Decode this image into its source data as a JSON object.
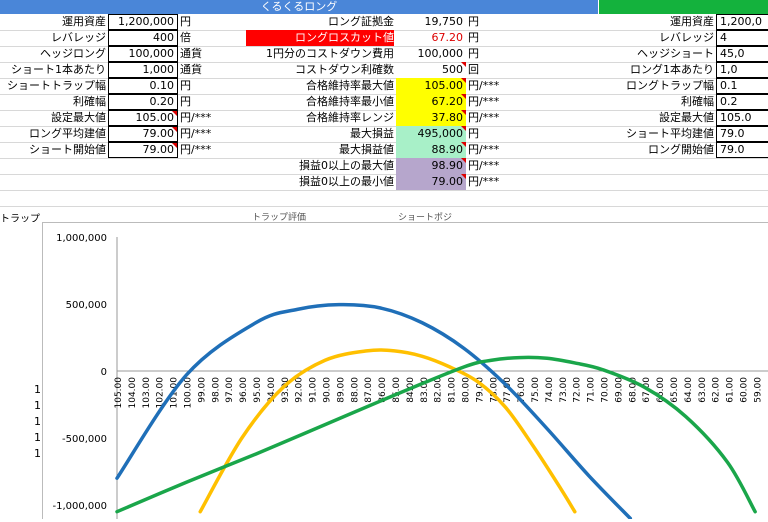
{
  "banner": {
    "title": "くるくるロング"
  },
  "left_block": [
    {
      "label": "運用資産",
      "value": "1,200,000",
      "unit": "円"
    },
    {
      "label": "レバレッジ",
      "value": "400",
      "unit": "倍"
    },
    {
      "label": "ヘッジロング",
      "value": "100,000",
      "unit": "通貨"
    },
    {
      "label": "ショート1本あたり",
      "value": "1,000",
      "unit": "通貨"
    },
    {
      "label": "ショートトラップ幅",
      "value": "0.10",
      "unit": "円"
    },
    {
      "label": "利確幅",
      "value": "0.20",
      "unit": "円"
    },
    {
      "label": "設定最大値",
      "value": "105.00",
      "unit": "円/***"
    },
    {
      "label": "ロング平均建値",
      "value": "79.00",
      "unit": "円/***"
    },
    {
      "label": "ショート開始値",
      "value": "79.00",
      "unit": "円/***"
    }
  ],
  "mid_block": [
    {
      "label": "ロング証拠金",
      "value": "19,750",
      "unit": "円"
    },
    {
      "label": "ロングロスカット値",
      "value": "67.20",
      "unit": "円"
    },
    {
      "label": "1円分のコストダウン費用",
      "value": "100,000",
      "unit": "円"
    },
    {
      "label": "コストダウン利確数",
      "value": "500",
      "unit": "回"
    },
    {
      "label": "合格維持率最大値",
      "value": "105.00",
      "unit": "円/***"
    },
    {
      "label": "合格維持率最小値",
      "value": "67.20",
      "unit": "円/***"
    },
    {
      "label": "合格維持率レンジ",
      "value": "37.80",
      "unit": "円/***"
    },
    {
      "label": "最大損益",
      "value": "495,000",
      "unit": "円"
    },
    {
      "label": "最大損益値",
      "value": "88.90",
      "unit": "円/***"
    },
    {
      "label": "損益0以上の最大値",
      "value": "98.90",
      "unit": "円/***"
    },
    {
      "label": "損益0以上の最小値",
      "value": "79.00",
      "unit": "円/***"
    }
  ],
  "right_block": [
    {
      "label": "運用資産",
      "value": "1,200,0"
    },
    {
      "label": "レバレッジ",
      "value": "4"
    },
    {
      "label": "ヘッジショート",
      "value": "45,0"
    },
    {
      "label": "ロング1本あたり",
      "value": "1,0"
    },
    {
      "label": "ロングトラップ幅",
      "value": "0.1"
    },
    {
      "label": "利確幅",
      "value": "0.2"
    },
    {
      "label": "設定最大値",
      "value": "105.0"
    },
    {
      "label": "ショート平均建値",
      "value": "79.0"
    },
    {
      "label": "ロング開始値",
      "value": "79.0"
    }
  ],
  "header_strip": {
    "left": "トラップ",
    "items": [
      "トラップ評価",
      "ショートポジ"
    ]
  },
  "row_stubs": [
    "1",
    "1",
    "1",
    "1",
    "1"
  ],
  "colors": {
    "banner_blue": "#4a86d8",
    "banner_green": "#14b23d",
    "red_cell": "#ff0000",
    "yellow_cell": "#ffff00",
    "mint_cell": "#a8f0c8",
    "lavender_cell": "#b6a6cc",
    "series_blue": "#1f6fb8",
    "series_orange": "#ffc000",
    "series_green": "#1aa64a"
  },
  "chart_data": {
    "type": "line",
    "y_ticks": [
      "1,000,000",
      "500,000",
      "0",
      "-500,000",
      "-1,000,000"
    ],
    "ylim": [
      -1000000,
      1000000
    ],
    "x_categories": [
      "105.00",
      "104.00",
      "103.00",
      "102.00",
      "101.00",
      "100.00",
      "99.00",
      "98.00",
      "97.00",
      "96.00",
      "95.00",
      "94.00",
      "93.00",
      "92.00",
      "91.00",
      "90.00",
      "89.00",
      "88.00",
      "87.00",
      "86.00",
      "85.00",
      "84.00",
      "83.00",
      "82.00",
      "81.00",
      "80.00",
      "79.00",
      "78.00",
      "77.00",
      "76.00",
      "75.00",
      "74.00",
      "73.00",
      "72.00",
      "71.00",
      "70.00",
      "69.00",
      "68.00",
      "67.00",
      "66.00",
      "65.00",
      "64.00",
      "63.00",
      "62.00",
      "61.00",
      "60.00",
      "59.00"
    ],
    "series": [
      {
        "color": "#1f6fb8",
        "x": [
          105,
          100,
          95,
          92,
          89,
          86,
          83,
          80,
          77,
          74,
          71,
          68
        ],
        "y": [
          -800000,
          -30000,
          360000,
          460000,
          495000,
          470000,
          360000,
          170000,
          -100000,
          -430000,
          -780000,
          -1100000
        ]
      },
      {
        "color": "#ffc000",
        "x": [
          99,
          96,
          93,
          90,
          87,
          85,
          83,
          81,
          79,
          77,
          75,
          73,
          72
        ],
        "y": [
          -1050000,
          -500000,
          -120000,
          80000,
          150000,
          150000,
          110000,
          30000,
          -80000,
          -270000,
          -560000,
          -880000,
          -1050000
        ]
      },
      {
        "color": "#1aa64a",
        "x": [
          105,
          100,
          95,
          90,
          85,
          80,
          78,
          76,
          74,
          72,
          70,
          67,
          64,
          61,
          59
        ],
        "y": [
          -1050000,
          -830000,
          -620000,
          -400000,
          -180000,
          30000,
          80000,
          100000,
          95000,
          60000,
          10000,
          -120000,
          -340000,
          -680000,
          -1050000
        ]
      }
    ]
  }
}
